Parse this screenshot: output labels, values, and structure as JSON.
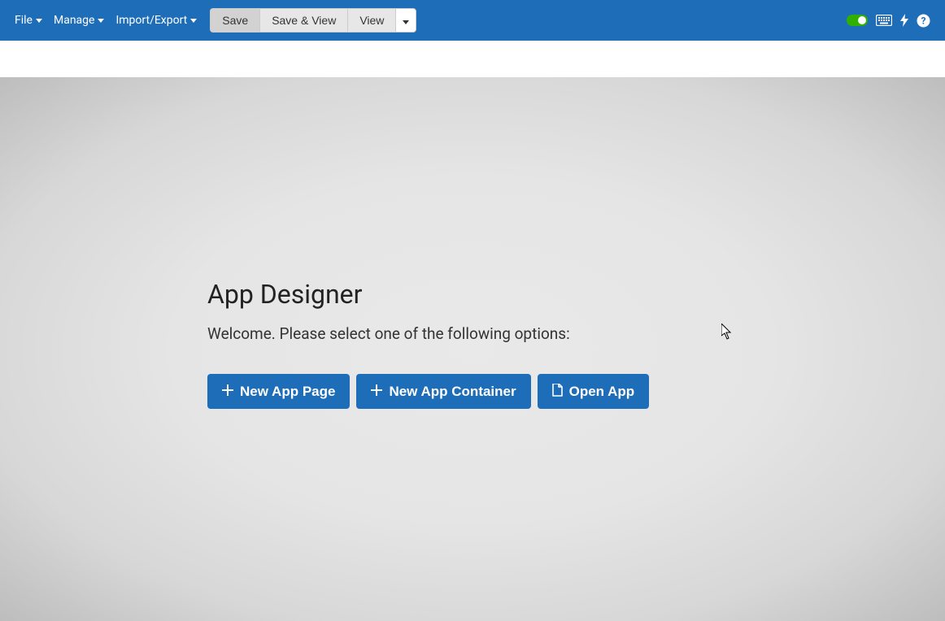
{
  "toolbar": {
    "menus": [
      {
        "label": "File"
      },
      {
        "label": "Manage"
      },
      {
        "label": "Import/Export"
      }
    ],
    "buttons": {
      "save": "Save",
      "save_view": "Save & View",
      "view": "View"
    }
  },
  "main": {
    "title": "App Designer",
    "subtitle": "Welcome. Please select one of the following options:",
    "actions": {
      "new_page": "New App Page",
      "new_container": "New App Container",
      "open_app": "Open App"
    }
  }
}
